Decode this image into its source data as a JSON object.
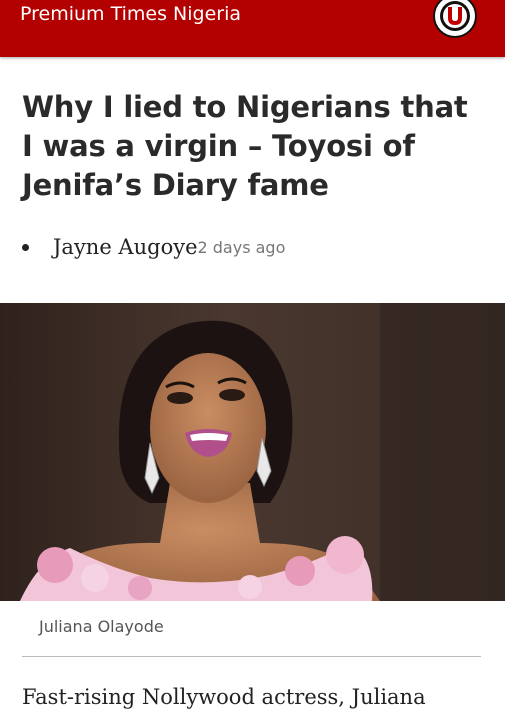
{
  "header": {
    "site_name": "Premium Times Nigeria",
    "logo_icon": "premium-times-logo-icon",
    "bar_color": "#b30000"
  },
  "article": {
    "title": "Why I lied to Nigerians that I was a virgin – Toyosi of Jenifa’s Diary fame",
    "author": "Jayne Augoye",
    "time_ago": "2 days ago",
    "image_caption": "Juliana Olayode",
    "lead_text": "Fast-rising Nollywood actress, Juliana"
  }
}
